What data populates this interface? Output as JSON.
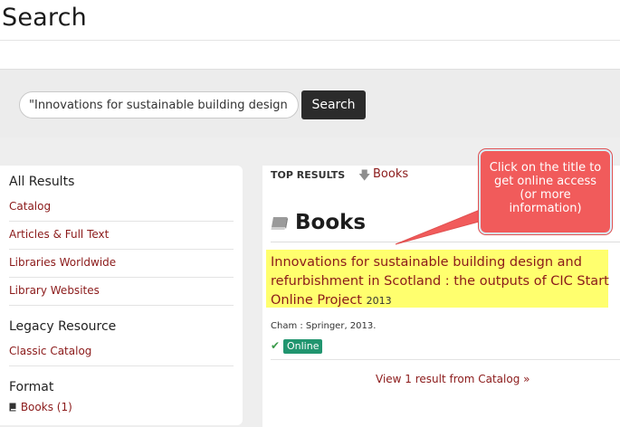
{
  "page": {
    "title": "Search"
  },
  "search": {
    "value": "\"Innovations for sustainable building design\"",
    "button_label": "Search"
  },
  "sidebar": {
    "all_results_heading": "All Results",
    "links": [
      "Catalog",
      "Articles & Full Text",
      "Libraries Worldwide",
      "Library Websites"
    ],
    "legacy_heading": "Legacy Resource",
    "legacy_link": "Classic Catalog",
    "format_heading": "Format",
    "format_item": "Books (1)"
  },
  "main": {
    "top_results_label": "TOP RESULTS",
    "books_jump": "Books",
    "section_heading": "Books",
    "result": {
      "title": "Innovations for sustainable building design and refurbishment in Scotland : the outputs of CIC Start Online Project",
      "year": "2013",
      "publisher": "Cham : Springer, 2013.",
      "availability": "Online"
    },
    "view_more": "View 1 result from Catalog »"
  },
  "callout": {
    "text": "Click on the title to get online access (or more information)"
  },
  "colors": {
    "link": "#8b1a1a",
    "highlight": "#ffff6e",
    "callout": "#f15b5b",
    "online_badge": "#21956f",
    "search_button": "#2b2b2b"
  },
  "icons": [
    "arrow-down-icon",
    "book-icon",
    "check-icon"
  ]
}
